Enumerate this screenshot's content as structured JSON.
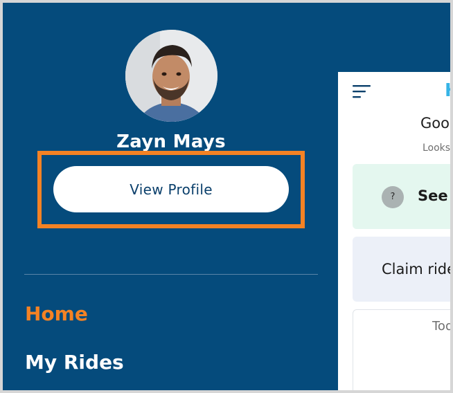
{
  "drawer": {
    "user_name": "Zayn Mays",
    "view_profile_label": "View Profile",
    "nav_items": [
      {
        "label": "Home",
        "active": true
      },
      {
        "label": "My Rides",
        "active": false
      }
    ],
    "highlight_color": "#f48224",
    "background_color": "#054b7c"
  },
  "preview": {
    "logo_fragment": "H",
    "greeting": "Good",
    "subtext": "Looks",
    "help_card": {
      "icon": "?",
      "label": "See h"
    },
    "claim_card": {
      "label": "Claim ride"
    },
    "bottom_card": {
      "label": "Tod"
    }
  },
  "icons": [
    "avatar-photo",
    "hamburger-menu-icon",
    "question-mark-icon"
  ]
}
